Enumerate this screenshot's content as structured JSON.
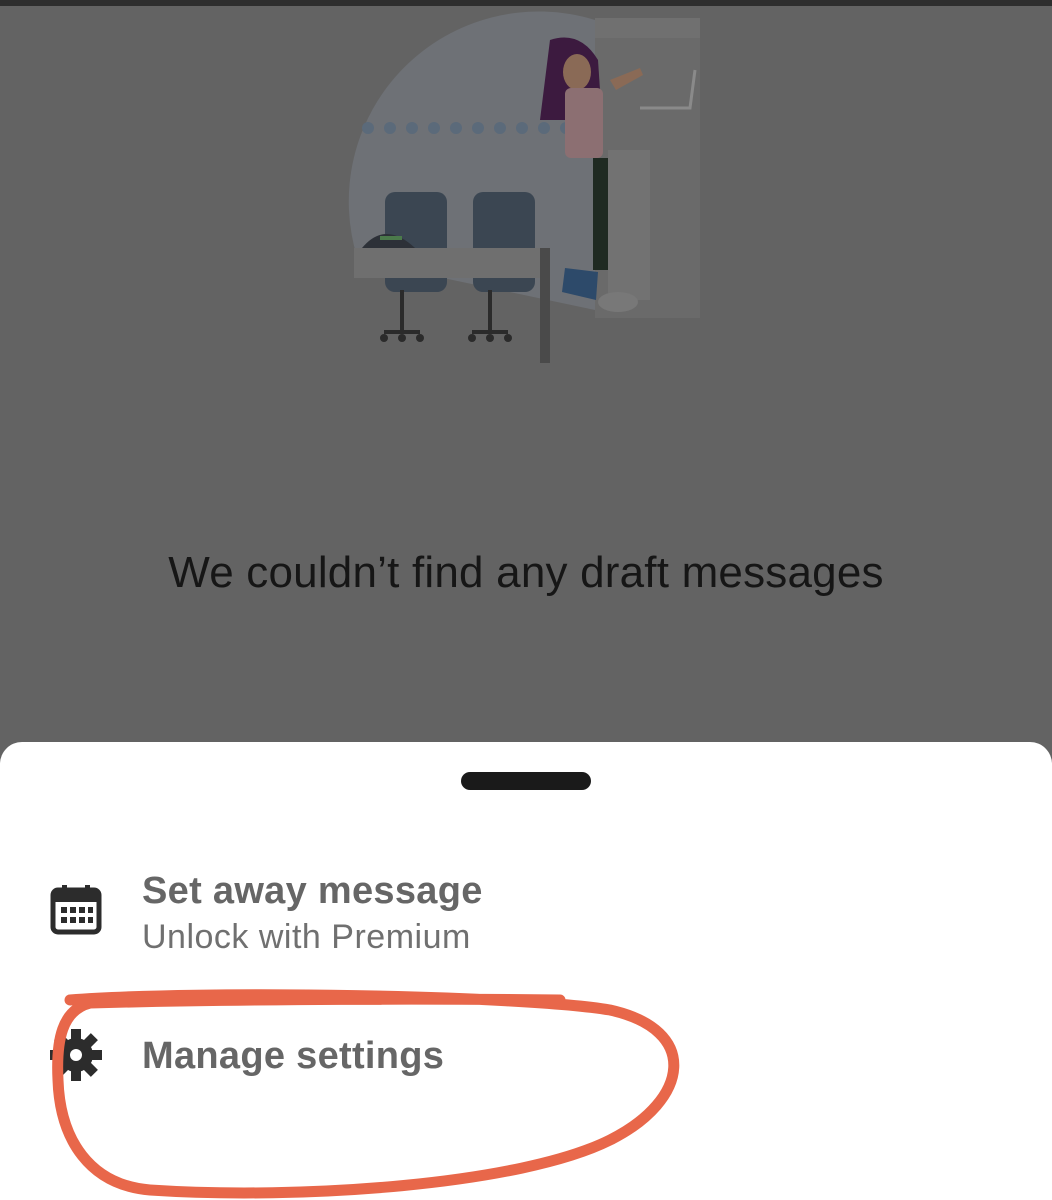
{
  "empty_state": {
    "message": "We couldn’t find any draft messages",
    "illustration": "person-peeking-office-illustration"
  },
  "sheet": {
    "items": [
      {
        "title": "Set away message",
        "subtitle": "Unlock with Premium",
        "icon": "calendar-icon"
      },
      {
        "title": "Manage settings",
        "icon": "gear-icon"
      }
    ]
  },
  "colors": {
    "overlay": "#636363",
    "sheet": "#ffffff",
    "annotation": "#e8674a"
  }
}
